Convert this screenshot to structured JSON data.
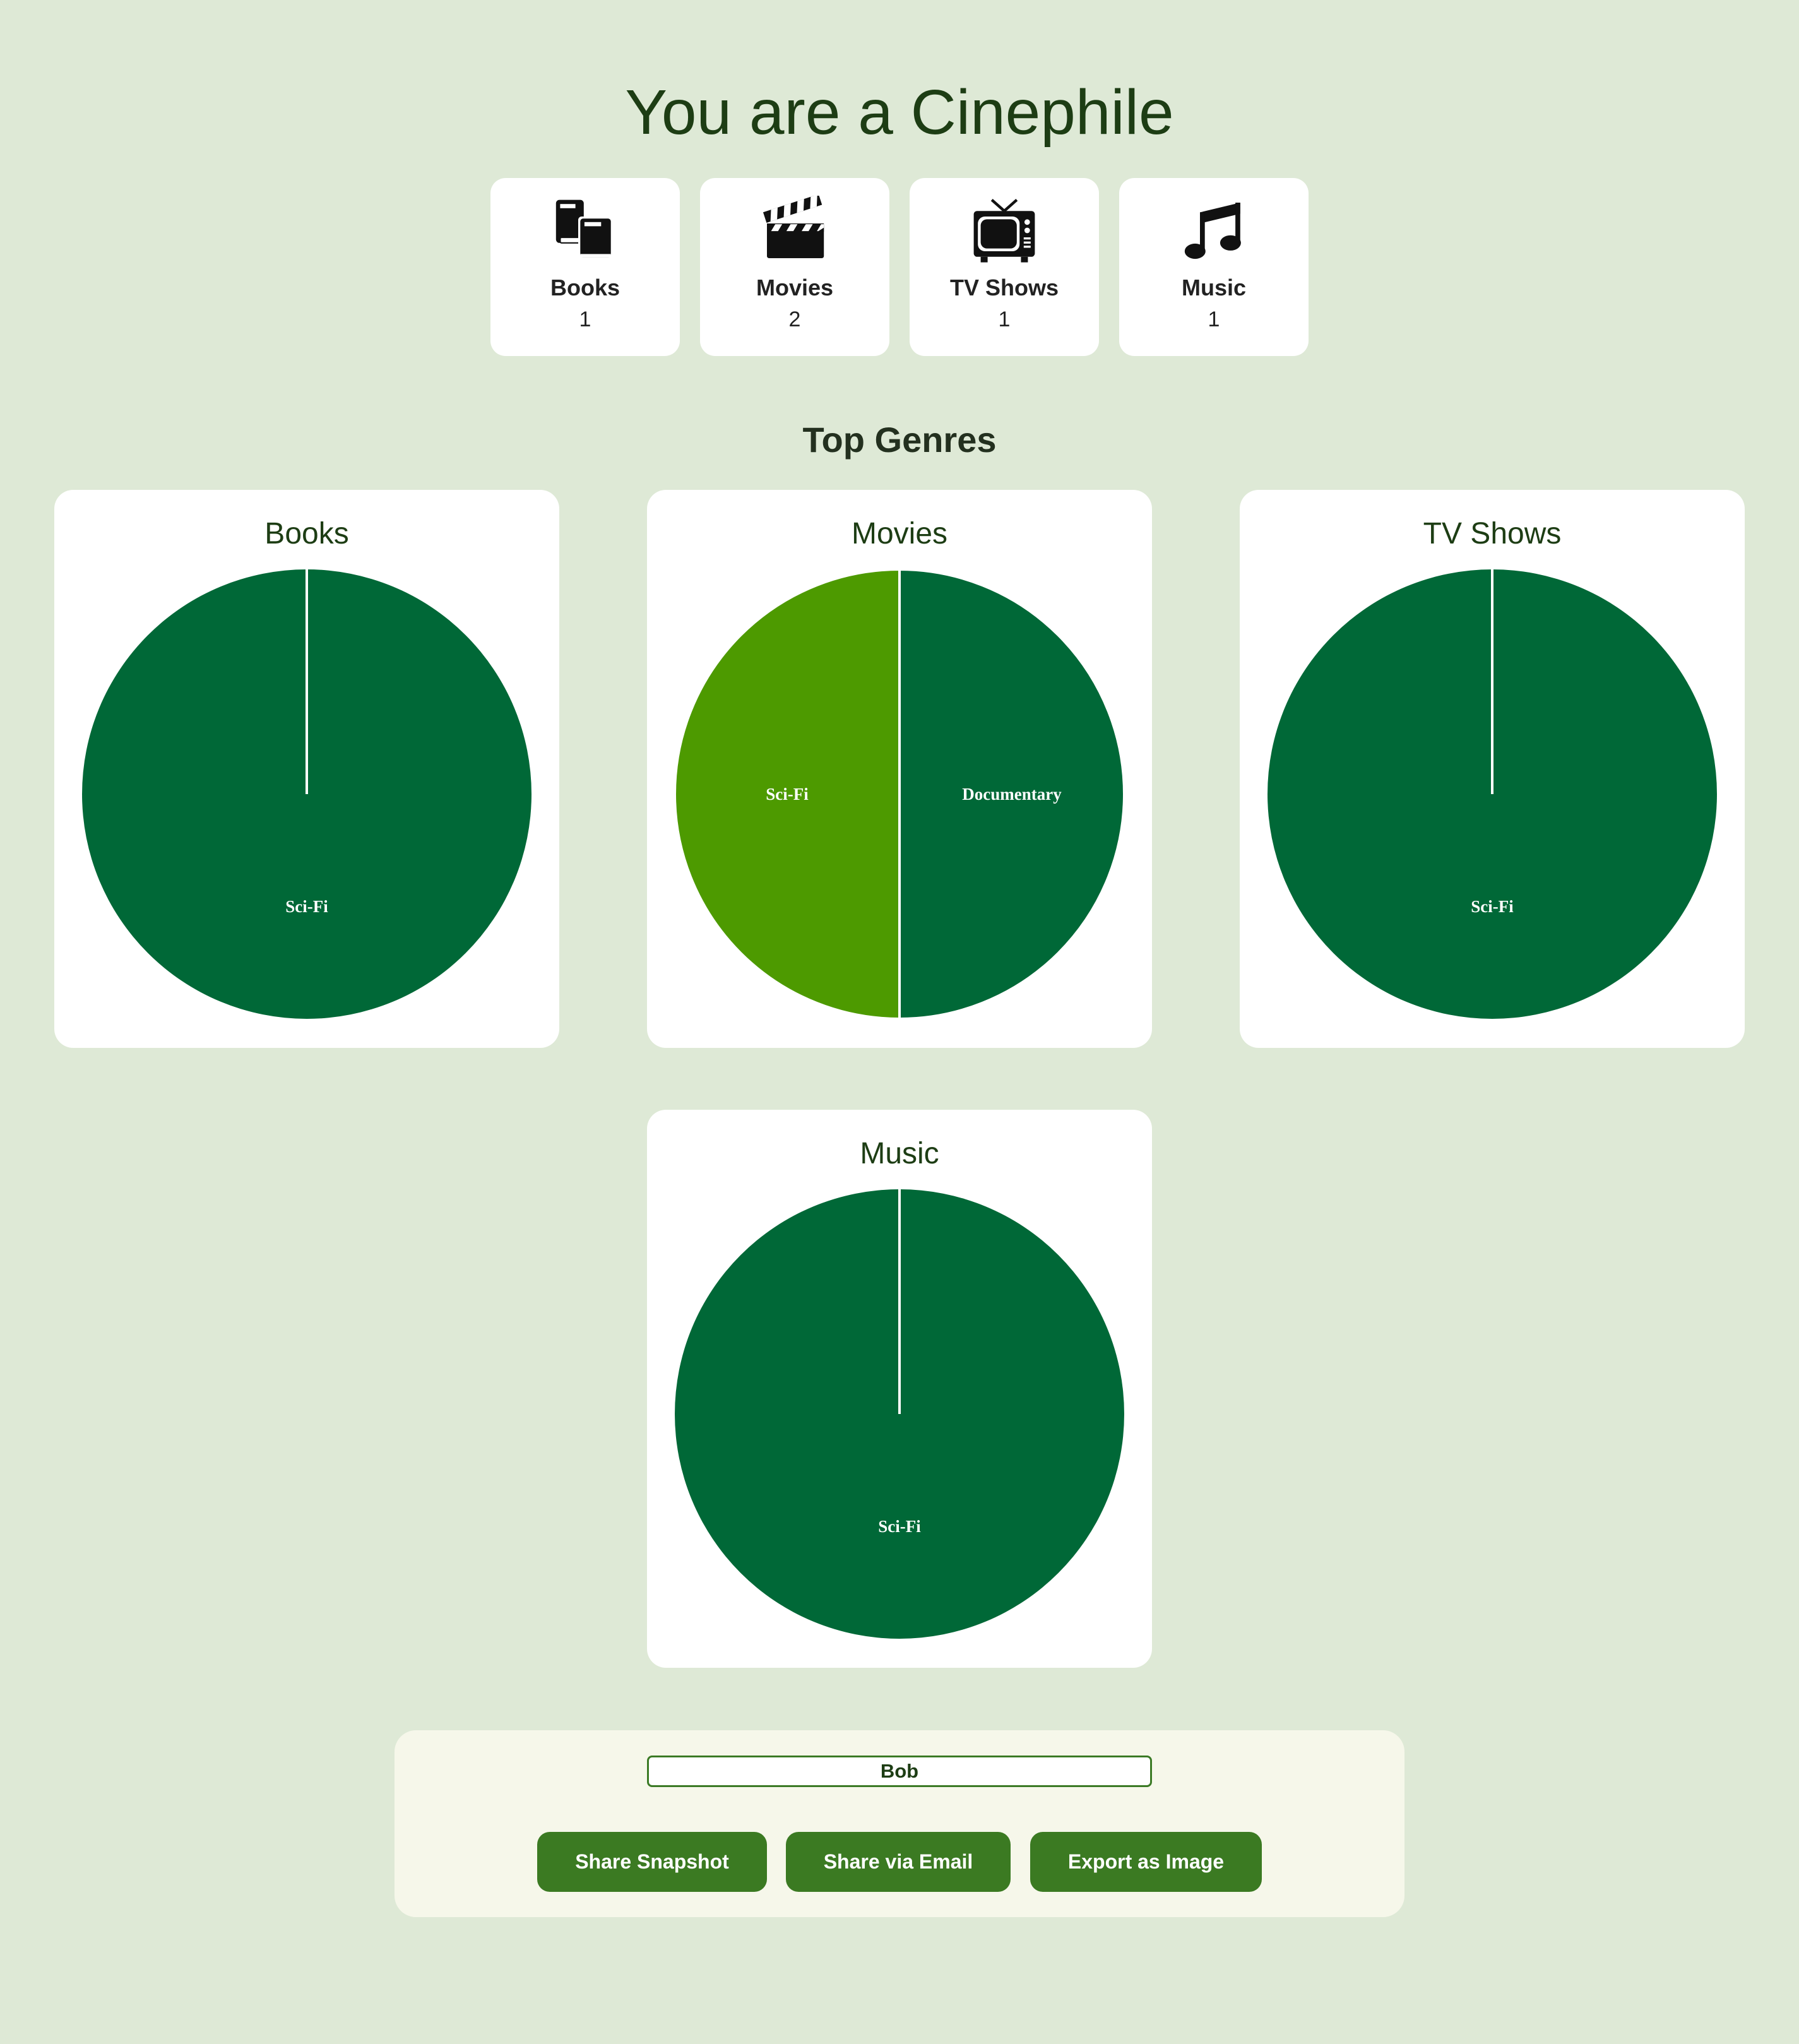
{
  "header": {
    "title": "You are a Cinephile"
  },
  "categories": [
    {
      "name": "Books",
      "count": "1",
      "icon": "books-icon"
    },
    {
      "name": "Movies",
      "count": "2",
      "icon": "clapperboard-icon"
    },
    {
      "name": "TV Shows",
      "count": "1",
      "icon": "television-icon"
    },
    {
      "name": "Music",
      "count": "1",
      "icon": "music-note-icon"
    }
  ],
  "genres": {
    "title": "Top Genres"
  },
  "colors": {
    "dark_green": "#006837",
    "light_green": "#4d9a00",
    "accent": "#3b7a22",
    "background": "#dee9d6"
  },
  "chart_data": [
    {
      "type": "pie",
      "title": "Books",
      "slices": [
        {
          "label": "Sci-Fi",
          "value": 1,
          "color": "#006837"
        }
      ]
    },
    {
      "type": "pie",
      "title": "Movies",
      "slices": [
        {
          "label": "Documentary",
          "value": 1,
          "color": "#006837"
        },
        {
          "label": "Sci-Fi",
          "value": 1,
          "color": "#4d9a00"
        }
      ]
    },
    {
      "type": "pie",
      "title": "TV Shows",
      "slices": [
        {
          "label": "Sci-Fi",
          "value": 1,
          "color": "#006837"
        }
      ]
    },
    {
      "type": "pie",
      "title": "Music",
      "slices": [
        {
          "label": "Sci-Fi",
          "value": 1,
          "color": "#006837"
        }
      ]
    }
  ],
  "share": {
    "name_value": "Bob",
    "buttons": {
      "snapshot": "Share Snapshot",
      "email": "Share via Email",
      "export": "Export as Image"
    }
  }
}
